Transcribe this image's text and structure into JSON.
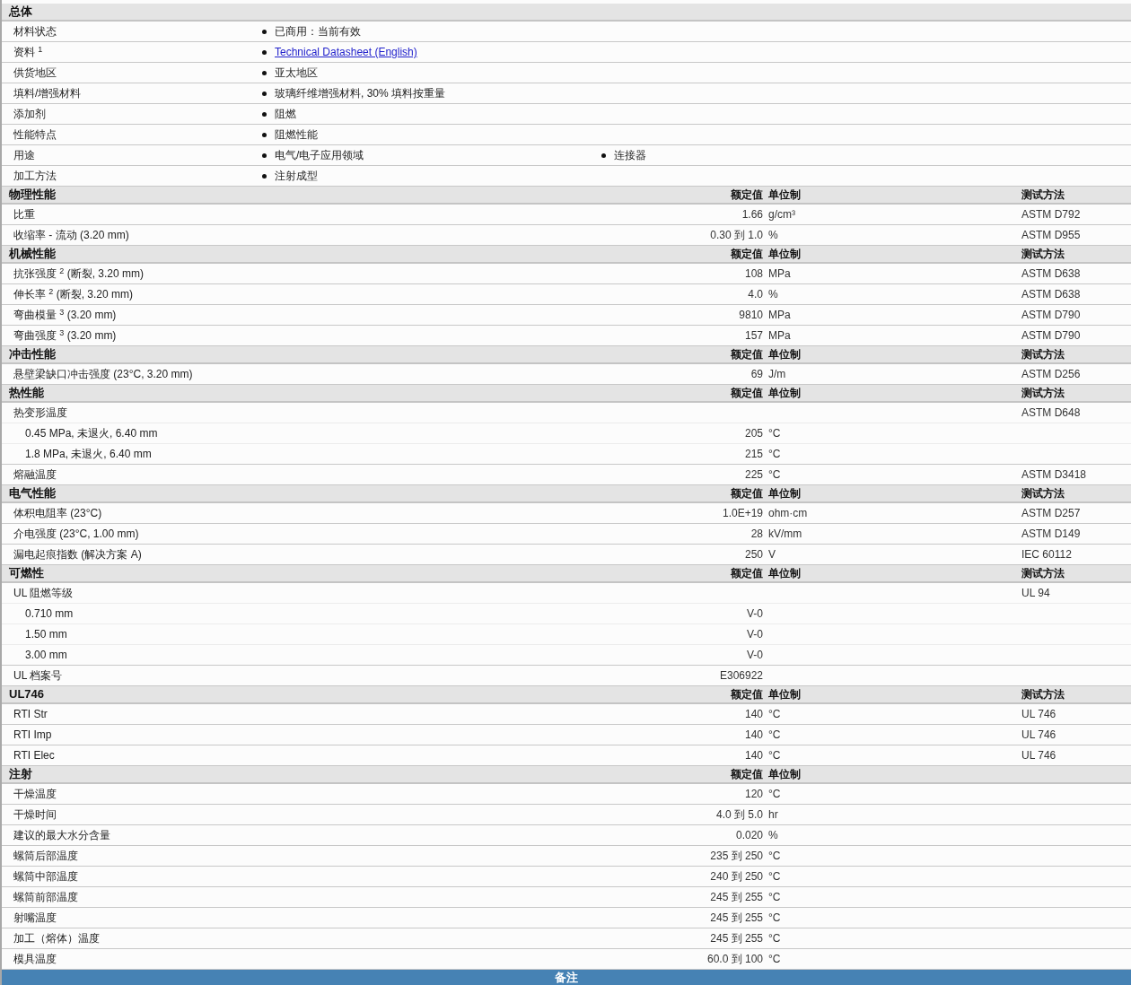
{
  "sections": [
    {
      "kind": "general",
      "title": "总体",
      "rows": [
        {
          "label": "材料状态",
          "values": [
            {
              "kind": "text",
              "text": "已商用：当前有效"
            }
          ]
        },
        {
          "label": "资料 $^{1}$",
          "values": [
            {
              "kind": "link",
              "text": "Technical Datasheet (English)"
            }
          ]
        },
        {
          "label": "供货地区",
          "values": [
            {
              "kind": "text",
              "text": "亚太地区"
            }
          ]
        },
        {
          "label": "填料/增强材料",
          "values": [
            {
              "kind": "text",
              "text": "玻璃纤维增强材料, 30% 填料按重量"
            }
          ]
        },
        {
          "label": "添加剂",
          "values": [
            {
              "kind": "text",
              "text": "阻燃"
            }
          ]
        },
        {
          "label": "性能特点",
          "values": [
            {
              "kind": "text",
              "text": "阻燃性能"
            }
          ]
        },
        {
          "label": "用途",
          "values": [
            {
              "kind": "text",
              "text": "电气/电子应用领域"
            },
            {
              "kind": "text",
              "text": "连接器"
            }
          ]
        },
        {
          "label": "加工方法",
          "values": [
            {
              "kind": "text",
              "text": "注射成型"
            }
          ]
        }
      ]
    },
    {
      "kind": "properties",
      "title": "物理性能",
      "headers": {
        "value": "额定值",
        "unit": "单位制",
        "method": "测试方法"
      },
      "rows": [
        {
          "label": "比重",
          "value": "1.66",
          "unit": "g/cm³",
          "method": "ASTM D792"
        },
        {
          "label": "收缩率 - 流动 (3.20 mm)",
          "value": "0.30 到 1.0",
          "unit": "%",
          "method": "ASTM D955"
        }
      ]
    },
    {
      "kind": "properties",
      "title": "机械性能",
      "headers": {
        "value": "额定值",
        "unit": "单位制",
        "method": "测试方法"
      },
      "rows": [
        {
          "label": "抗张强度 $^{2}$ (断裂, 3.20 mm)",
          "value": "108",
          "unit": "MPa",
          "method": "ASTM D638"
        },
        {
          "label": "伸长率 $^{2}$ (断裂, 3.20 mm)",
          "value": "4.0",
          "unit": "%",
          "method": "ASTM D638"
        },
        {
          "label": "弯曲模量 $^{3}$ (3.20 mm)",
          "value": "9810",
          "unit": "MPa",
          "method": "ASTM D790"
        },
        {
          "label": "弯曲强度 $^{3}$ (3.20 mm)",
          "value": "157",
          "unit": "MPa",
          "method": "ASTM D790"
        }
      ]
    },
    {
      "kind": "properties",
      "title": "冲击性能",
      "headers": {
        "value": "额定值",
        "unit": "单位制",
        "method": "测试方法"
      },
      "rows": [
        {
          "label": "悬壁梁缺口冲击强度 (23°C, 3.20 mm)",
          "value": "69",
          "unit": "J/m",
          "method": "ASTM D256"
        }
      ]
    },
    {
      "kind": "properties",
      "title": "热性能",
      "headers": {
        "value": "额定值",
        "unit": "单位制",
        "method": "测试方法"
      },
      "rows": [
        {
          "label": "热变形温度",
          "method": "ASTM D648",
          "children": [
            {
              "label": "0.45 MPa, 未退火, 6.40 mm",
              "value": "205",
              "unit": "°C"
            },
            {
              "label": "1.8 MPa, 未退火, 6.40 mm",
              "value": "215",
              "unit": "°C"
            }
          ]
        },
        {
          "label": "熔融温度",
          "value": "225",
          "unit": "°C",
          "method": "ASTM D3418"
        }
      ]
    },
    {
      "kind": "properties",
      "title": "电气性能",
      "headers": {
        "value": "额定值",
        "unit": "单位制",
        "method": "测试方法"
      },
      "rows": [
        {
          "label": "体积电阻率 (23°C)",
          "value": "1.0E+19",
          "unit": "ohm·cm",
          "method": "ASTM D257"
        },
        {
          "label": "介电强度 (23°C, 1.00 mm)",
          "value": "28",
          "unit": "kV/mm",
          "method": "ASTM D149"
        },
        {
          "label": "漏电起痕指数 (解决方案 A)",
          "value": "250",
          "unit": "V",
          "method": "IEC 60112"
        }
      ]
    },
    {
      "kind": "properties",
      "title": "可燃性",
      "headers": {
        "value": "额定值",
        "unit": "单位制",
        "method": "测试方法"
      },
      "rows": [
        {
          "label": "UL 阻燃等级",
          "method": "UL 94",
          "children": [
            {
              "label": "0.710 mm",
              "value": "V-0"
            },
            {
              "label": "1.50 mm",
              "value": "V-0"
            },
            {
              "label": "3.00 mm",
              "value": "V-0"
            }
          ]
        },
        {
          "label": "UL 档案号",
          "value": "E306922"
        }
      ]
    },
    {
      "kind": "properties",
      "title": "UL746",
      "headers": {
        "value": "额定值",
        "unit": "单位制",
        "method": "测试方法"
      },
      "rows": [
        {
          "label": "RTI Str",
          "value": "140",
          "unit": "°C",
          "method": "UL 746"
        },
        {
          "label": "RTI Imp",
          "value": "140",
          "unit": "°C",
          "method": "UL 746"
        },
        {
          "label": "RTI Elec",
          "value": "140",
          "unit": "°C",
          "method": "UL 746"
        }
      ]
    },
    {
      "kind": "properties",
      "title": "注射",
      "headers": {
        "value": "额定值",
        "unit": "单位制"
      },
      "rows": [
        {
          "label": "干燥温度",
          "value": "120",
          "unit": "°C"
        },
        {
          "label": "干燥时间",
          "value": "4.0 到 5.0",
          "unit": "hr"
        },
        {
          "label": "建议的最大水分含量",
          "value": "0.020",
          "unit": "%"
        },
        {
          "label": "螺筒后部温度",
          "value": "235 到 250",
          "unit": "°C"
        },
        {
          "label": "螺筒中部温度",
          "value": "240 到 250",
          "unit": "°C"
        },
        {
          "label": "螺筒前部温度",
          "value": "245 到 255",
          "unit": "°C"
        },
        {
          "label": "射嘴温度",
          "value": "245 到 255",
          "unit": "°C"
        },
        {
          "label": "加工（熔体）温度",
          "value": "245 到 255",
          "unit": "°C"
        },
        {
          "label": "模具温度",
          "value": "60.0 到 100",
          "unit": "°C"
        }
      ]
    }
  ],
  "footer": {
    "title": "备注"
  }
}
